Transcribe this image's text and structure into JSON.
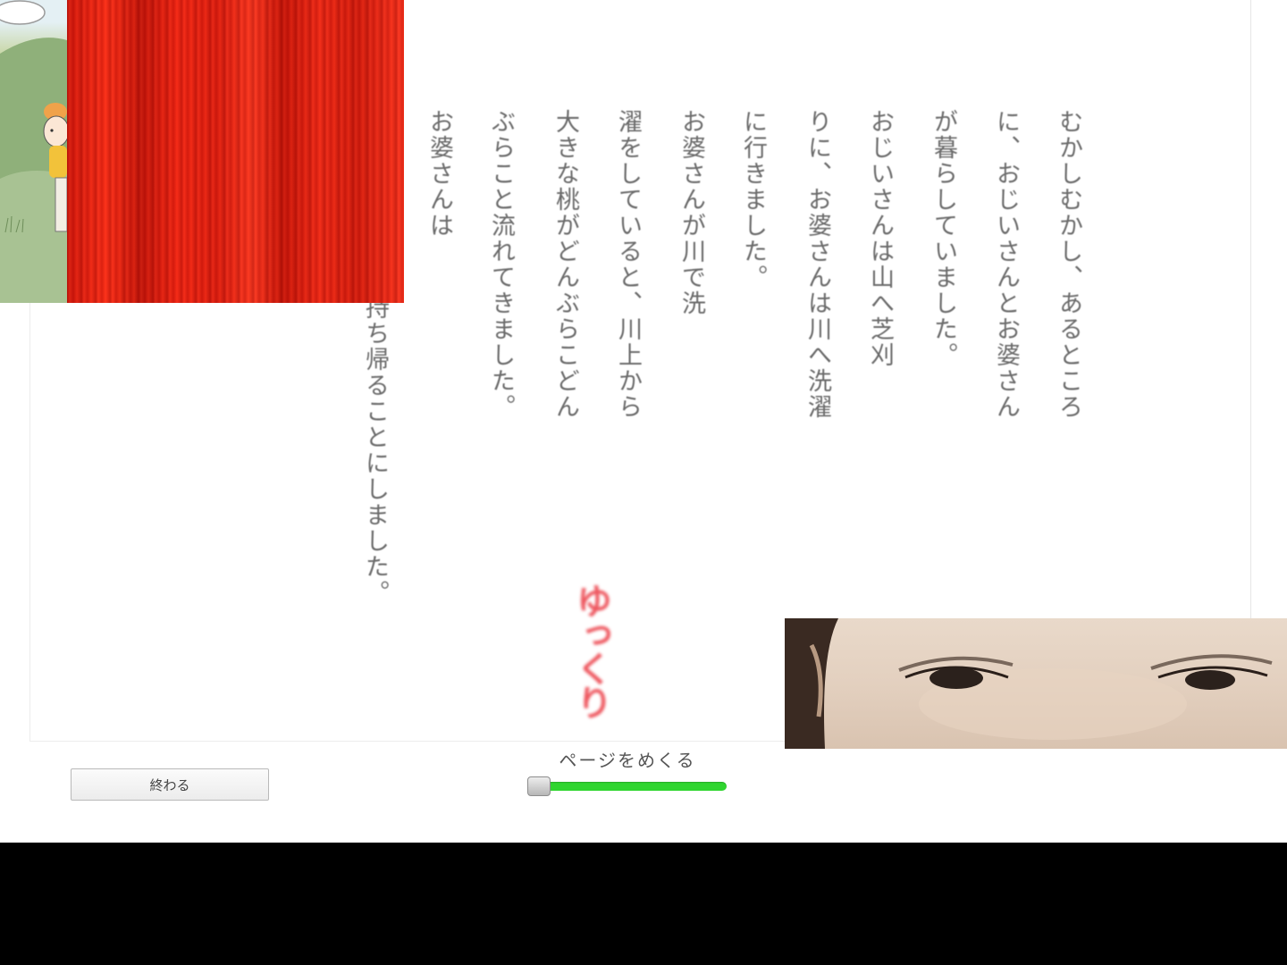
{
  "story": {
    "columns": [
      "むかしむかし、あるところ",
      "に、おじいさんとお婆さん",
      "が暮らしていました。",
      "おじいさんは山へ芝刈",
      "りに、お婆さんは川へ洗濯",
      "に行きました。",
      "お婆さんが川で洗",
      "濯をしていると、川上から",
      "大きな桃がどんぶらこどん",
      "ぶらこと流れてきました。",
      "お婆さんは"
    ],
    "partially_hidden_column": "持ち帰ることにしました。"
  },
  "pace_indicator": "ゆっくり",
  "controls": {
    "exit_label": "終わる",
    "page_turn_label": "ページをめくる",
    "page_turn_progress": 0
  }
}
